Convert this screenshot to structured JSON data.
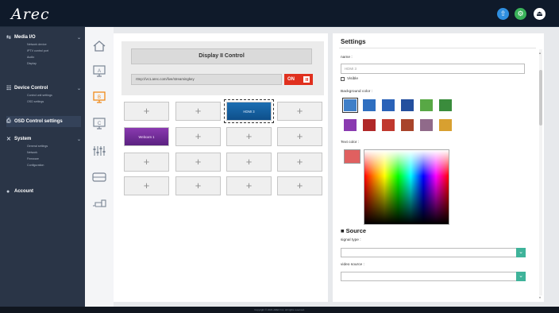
{
  "app": {
    "logo": "Arec"
  },
  "topbar": {
    "icons": [
      {
        "name": "upload-icon",
        "color": "#2f8fe0",
        "glyph": "⇧"
      },
      {
        "name": "settings-icon",
        "color": "#3ab25a",
        "glyph": "⚙"
      },
      {
        "name": "logout-icon",
        "color": "#ffffff",
        "glyph": "⏏"
      }
    ]
  },
  "sidebar": {
    "media": {
      "label": "Media I/O",
      "items": [
        "Network device",
        "IPTV control port",
        "Audio",
        "Display"
      ]
    },
    "device": {
      "label": "Device Control",
      "items": [
        "Control unit settings",
        "OSD settings"
      ]
    },
    "osd": {
      "label": "OSD Control settings"
    },
    "system": {
      "label": "System",
      "items": [
        "General settings",
        "Network",
        "Firmware",
        "Configuration"
      ]
    },
    "account": {
      "label": "Account"
    }
  },
  "display": {
    "title": "Display II Control",
    "url": "rtmp://vc1.arec.com/live/streamingkey",
    "toggle_label": "ON"
  },
  "grid": {
    "cells": [
      "+",
      "+",
      "HDMI 3",
      "+",
      "Webcam 1",
      "+",
      "+",
      "+",
      "+",
      "+",
      "+",
      "+",
      "+",
      "+",
      "+",
      "+"
    ]
  },
  "settings": {
    "title": "Settings",
    "name_label": "name :",
    "name_value": "HDMI 3",
    "visible_label": "Visible",
    "bg_label": "Background color :",
    "text_label": "Text color :",
    "bg_colors": [
      "#3f7fc8",
      "#2f6fc0",
      "#2a62b8",
      "#244f9e",
      "#58a845",
      "#3a8c3c",
      "#8a3ab0",
      "#b02828",
      "#c0382e",
      "#a8442a",
      "#906a8a",
      "#d8a030"
    ],
    "text_color": "#e06060",
    "source_title": "Source",
    "signal_label": "signal type :",
    "video_label": "video source :"
  },
  "footer": {
    "text": "Copyright © 2021 AREC Inc. All rights reserved."
  }
}
